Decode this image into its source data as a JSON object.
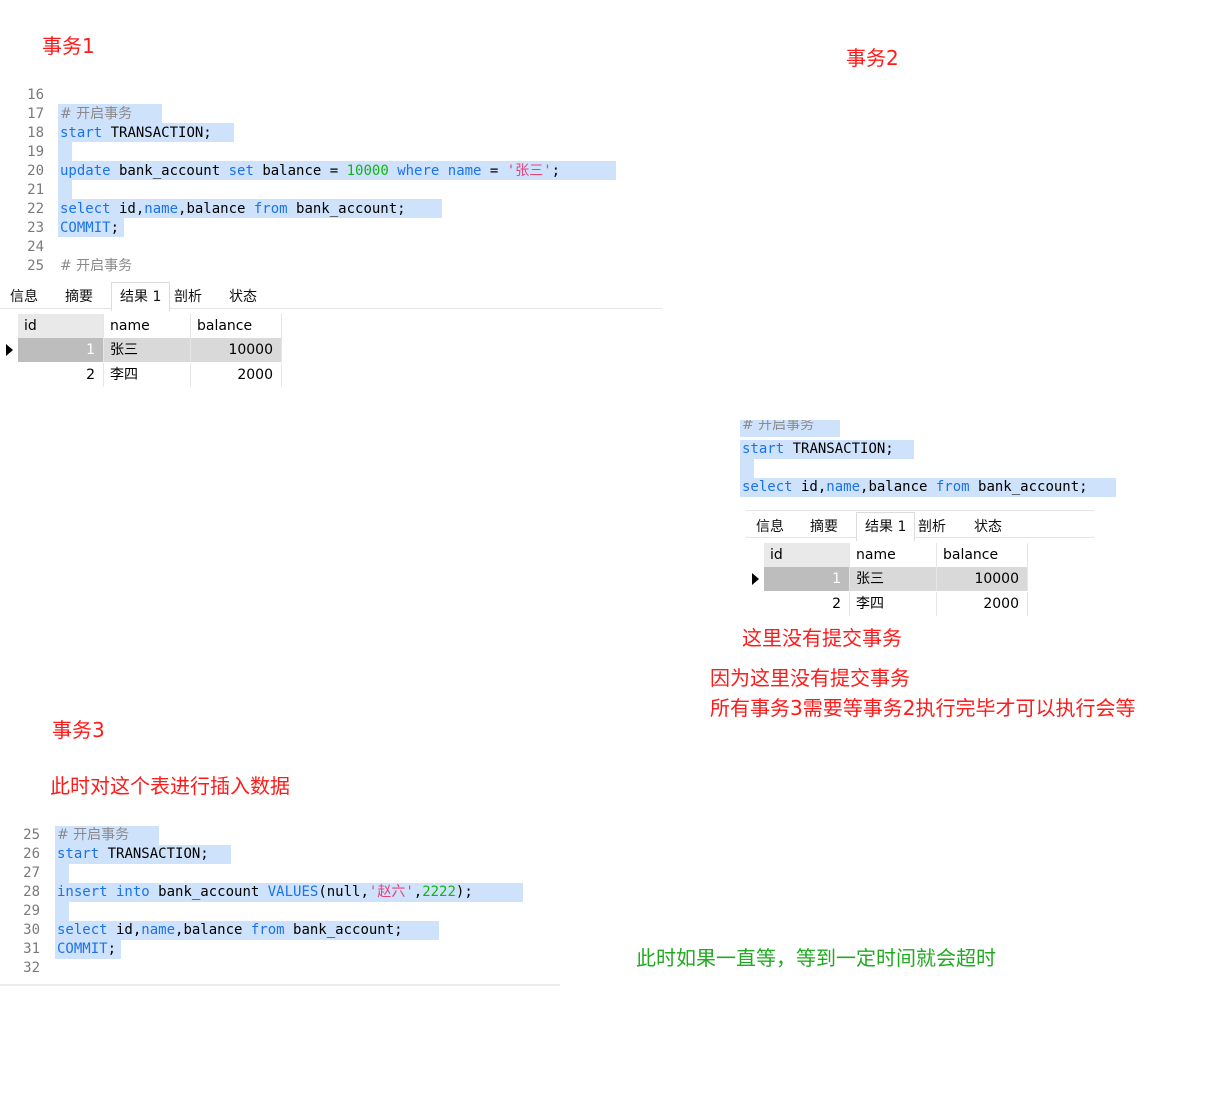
{
  "labels": {
    "tx1": "事务1",
    "tx2": "事务2",
    "tx3": "事务3",
    "tx3_desc": "此时对这个表进行插入数据",
    "no_commit": "这里没有提交事务",
    "explain_1": "因为这里没有提交事务",
    "explain_2": "所有事务3需要等事务2执行完毕才可以执行会等",
    "timeout": "此时如果一直等，等到一定时间就会超时"
  },
  "editor1": {
    "lines": [
      {
        "n": "16"
      },
      {
        "n": "17",
        "comment": "# 开启事务"
      },
      {
        "n": "18",
        "kw1": "start",
        "t1": " TRANSACTION;"
      },
      {
        "n": "19"
      },
      {
        "n": "20",
        "kw1": "update",
        "t1": " bank_account ",
        "kw2": "set",
        "t2": " balance = ",
        "num": "10000",
        "kw3": " where",
        "kw4": " name",
        "t3": " = ",
        "str": "'张三'",
        "t4": ";"
      },
      {
        "n": "21"
      },
      {
        "n": "22",
        "kw1": "select",
        "t1": " id,",
        "kw2": "name",
        "t2": ",balance ",
        "kw3": "from",
        "t3": " bank_account;"
      },
      {
        "n": "23",
        "kw1": "COMMIT",
        "t1": ";"
      },
      {
        "n": "24"
      },
      {
        "n": "25",
        "comment": "# 开启事务"
      }
    ]
  },
  "tabs": [
    "信息",
    "摘要",
    "结果 1",
    "剖析",
    "状态"
  ],
  "result1": {
    "columns": [
      "id",
      "name",
      "balance"
    ],
    "rows": [
      {
        "id": "1",
        "name": "张三",
        "balance": "10000"
      },
      {
        "id": "2",
        "name": "李四",
        "balance": "2000"
      }
    ]
  },
  "editor2": {
    "comment": "# 开启事务",
    "l1_kw": "start",
    "l1_t": " TRANSACTION;",
    "l3_kw1": "select",
    "l3_t1": " id,",
    "l3_kw2": "name",
    "l3_t2": ",balance ",
    "l3_kw3": "from",
    "l3_t3": " bank_account;"
  },
  "result2": {
    "columns": [
      "id",
      "name",
      "balance"
    ],
    "rows": [
      {
        "id": "1",
        "name": "张三",
        "balance": "10000"
      },
      {
        "id": "2",
        "name": "李四",
        "balance": "2000"
      }
    ]
  },
  "editor3": {
    "lines": [
      {
        "n": "25",
        "comment": "# 开启事务"
      },
      {
        "n": "26",
        "kw1": "start",
        "t1": " TRANSACTION;"
      },
      {
        "n": "27"
      },
      {
        "n": "28",
        "kw1": "insert",
        "kw2": " into",
        "t1": " bank_account ",
        "kw3": "VALUES",
        "t2": "(null,",
        "str": "'赵六'",
        "t3": ",",
        "num": "2222",
        "t4": ");"
      },
      {
        "n": "29"
      },
      {
        "n": "30",
        "kw1": "select",
        "t1": " id,",
        "kw2": "name",
        "t2": ",balance ",
        "kw3": "from",
        "t3": " bank_account;"
      },
      {
        "n": "31",
        "kw1": "COMMIT",
        "t1": ";"
      },
      {
        "n": "32"
      }
    ]
  },
  "colors": {
    "accent_red": "#ff1a1a",
    "accent_green": "#22aa22",
    "keyword": "#1a73e8",
    "highlight": "#cfe2fb"
  }
}
